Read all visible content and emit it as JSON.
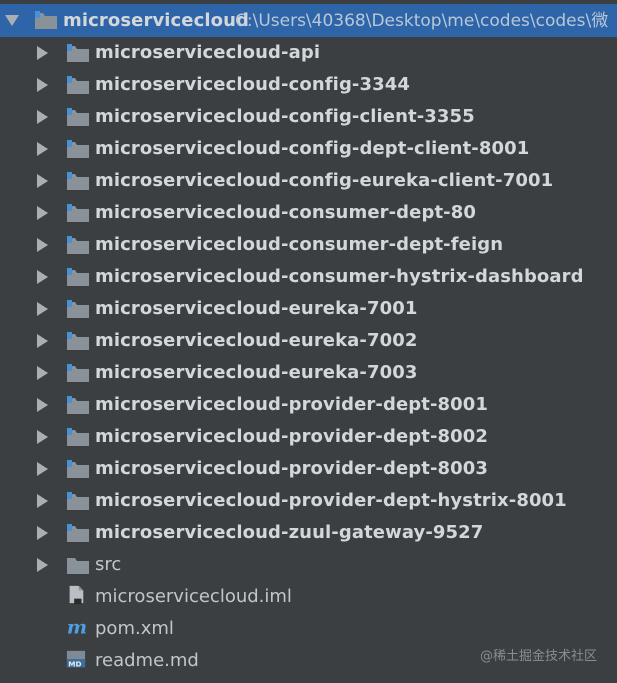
{
  "project": {
    "name": "microservicecloud",
    "path": "C:\\Users\\40368\\Desktop\\me\\codes\\codes\\微"
  },
  "modules": [
    "microservicecloud-api",
    "microservicecloud-config-3344",
    "microservicecloud-config-client-3355",
    "microservicecloud-config-dept-client-8001",
    "microservicecloud-config-eureka-client-7001",
    "microservicecloud-consumer-dept-80",
    "microservicecloud-consumer-dept-feign",
    "microservicecloud-consumer-hystrix-dashboard",
    "microservicecloud-eureka-7001",
    "microservicecloud-eureka-7002",
    "microservicecloud-eureka-7003",
    "microservicecloud-provider-dept-8001",
    "microservicecloud-provider-dept-8002",
    "microservicecloud-provider-dept-8003",
    "microservicecloud-provider-dept-hystrix-8001",
    "microservicecloud-zuul-gateway-9527"
  ],
  "folders": [
    "src"
  ],
  "files": [
    {
      "name": "microservicecloud.iml",
      "icon": "iml-file-icon"
    },
    {
      "name": "pom.xml",
      "icon": "maven-file-icon"
    },
    {
      "name": "readme.md",
      "icon": "markdown-file-icon"
    }
  ],
  "colors": {
    "background": "#3c3f41",
    "selection": "#2e64a8",
    "module_text": "#d4d7d9",
    "folder_icon": "#8a9299",
    "module_marker": "#4a90d9",
    "maven_icon": "#4f9ee3"
  },
  "watermark": "@稀土掘金技术社区"
}
